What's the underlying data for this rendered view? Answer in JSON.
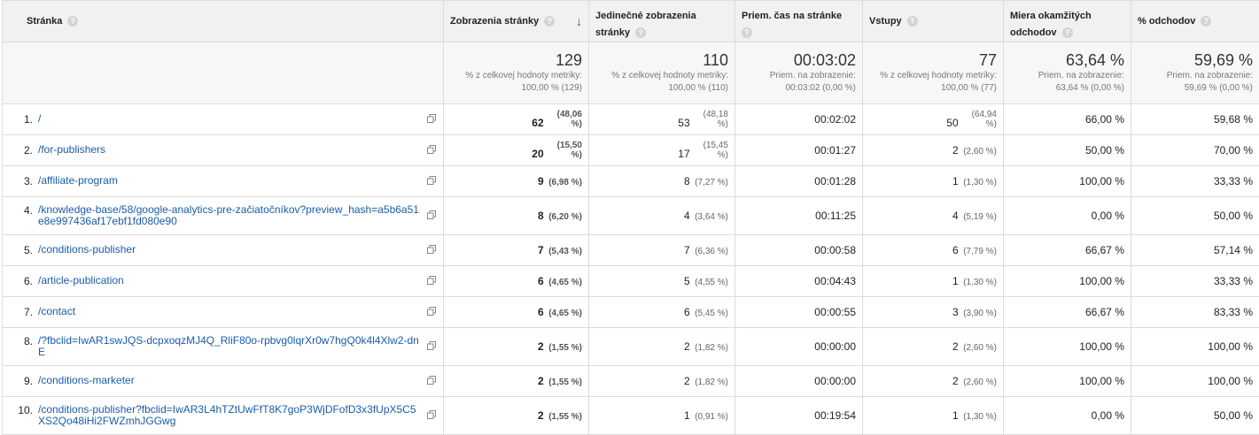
{
  "header": {
    "col1": "Stránka",
    "col2": "Zobrazenia stránky",
    "col3": "Jedinečné zobrazenia stránky",
    "col4": "Priem. čas na stránke",
    "col5": "Vstupy",
    "col6": "Miera okamžitých odchodov",
    "col7": "% odchodov",
    "help": "?",
    "sort_arrow": "↓"
  },
  "totals": {
    "pageviews": {
      "big": "129",
      "sub1": "% z celkovej hodnoty metriky:",
      "sub2": "100,00 % (129)"
    },
    "unique": {
      "big": "110",
      "sub1": "% z celkovej hodnoty metriky:",
      "sub2": "100,00 % (110)"
    },
    "avgtime": {
      "big": "00:03:02",
      "sub1": "Priem. na zobrazenie:",
      "sub2": "00:03:02 (0,00 %)"
    },
    "entrances": {
      "big": "77",
      "sub1": "% z celkovej hodnoty metriky:",
      "sub2": "100,00 % (77)"
    },
    "bounce": {
      "big": "63,64 %",
      "sub1": "Priem. na zobrazenie:",
      "sub2": "63,64 % (0,00 %)"
    },
    "exit": {
      "big": "59,69 %",
      "sub1": "Priem. na zobrazenie:",
      "sub2": "59,69 % (0,00 %)"
    }
  },
  "rows": [
    {
      "idx": "1.",
      "page": "/",
      "pv": "62",
      "pv_pct": "(48,06 %)",
      "up": "53",
      "up_pct": "(48,18 %)",
      "time": "00:02:02",
      "ent": "50",
      "ent_pct": "(64,94 %)",
      "bounce": "66,00 %",
      "exit": "59,68 %"
    },
    {
      "idx": "2.",
      "page": "/for-publishers",
      "pv": "20",
      "pv_pct": "(15,50 %)",
      "up": "17",
      "up_pct": "(15,45 %)",
      "time": "00:01:27",
      "ent": "2",
      "ent_pct": "(2,60 %)",
      "bounce": "50,00 %",
      "exit": "70,00 %"
    },
    {
      "idx": "3.",
      "page": "/affiliate-program",
      "pv": "9",
      "pv_pct": "(6,98 %)",
      "up": "8",
      "up_pct": "(7,27 %)",
      "time": "00:01:28",
      "ent": "1",
      "ent_pct": "(1,30 %)",
      "bounce": "100,00 %",
      "exit": "33,33 %"
    },
    {
      "idx": "4.",
      "page": "/knowledge-base/58/google-analytics-pre-začiatočníkov?preview_hash=a5b6a51e8e997436af17ebf1fd080e90",
      "pv": "8",
      "pv_pct": "(6,20 %)",
      "up": "4",
      "up_pct": "(3,64 %)",
      "time": "00:11:25",
      "ent": "4",
      "ent_pct": "(5,19 %)",
      "bounce": "0,00 %",
      "exit": "50,00 %"
    },
    {
      "idx": "5.",
      "page": "/conditions-publisher",
      "pv": "7",
      "pv_pct": "(5,43 %)",
      "up": "7",
      "up_pct": "(6,36 %)",
      "time": "00:00:58",
      "ent": "6",
      "ent_pct": "(7,79 %)",
      "bounce": "66,67 %",
      "exit": "57,14 %"
    },
    {
      "idx": "6.",
      "page": "/article-publication",
      "pv": "6",
      "pv_pct": "(4,65 %)",
      "up": "5",
      "up_pct": "(4,55 %)",
      "time": "00:04:43",
      "ent": "1",
      "ent_pct": "(1,30 %)",
      "bounce": "100,00 %",
      "exit": "33,33 %"
    },
    {
      "idx": "7.",
      "page": "/contact",
      "pv": "6",
      "pv_pct": "(4,65 %)",
      "up": "6",
      "up_pct": "(5,45 %)",
      "time": "00:00:55",
      "ent": "3",
      "ent_pct": "(3,90 %)",
      "bounce": "66,67 %",
      "exit": "83,33 %"
    },
    {
      "idx": "8.",
      "page": "/?fbclid=IwAR1swJQS-dcpxoqzMJ4Q_RliF80o-rpbvg0lqrXr0w7hgQ0k4l4Xlw2-dnE",
      "pv": "2",
      "pv_pct": "(1,55 %)",
      "up": "2",
      "up_pct": "(1,82 %)",
      "time": "00:00:00",
      "ent": "2",
      "ent_pct": "(2,60 %)",
      "bounce": "100,00 %",
      "exit": "100,00 %"
    },
    {
      "idx": "9.",
      "page": "/conditions-marketer",
      "pv": "2",
      "pv_pct": "(1,55 %)",
      "up": "2",
      "up_pct": "(1,82 %)",
      "time": "00:00:00",
      "ent": "2",
      "ent_pct": "(2,60 %)",
      "bounce": "100,00 %",
      "exit": "100,00 %"
    },
    {
      "idx": "10.",
      "page": "/conditions-publisher?fbclid=IwAR3L4hTZtUwFfT8K7goP3WjDFofD3x3fUpX5C5XS2Qo48iHi2FWZmhJGGwg",
      "pv": "2",
      "pv_pct": "(1,55 %)",
      "up": "1",
      "up_pct": "(0,91 %)",
      "time": "00:19:54",
      "ent": "1",
      "ent_pct": "(1,30 %)",
      "bounce": "0,00 %",
      "exit": "50,00 %"
    }
  ]
}
